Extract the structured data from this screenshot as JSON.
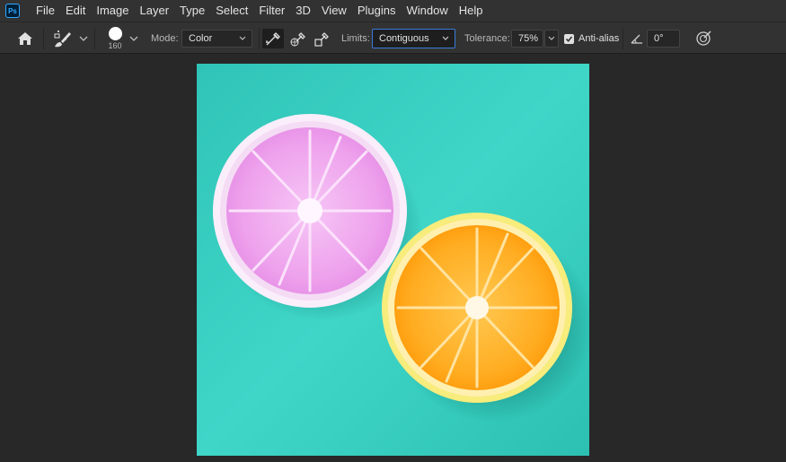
{
  "app": {
    "logo_text": "Ps"
  },
  "menu": {
    "items": [
      {
        "id": "file",
        "label": "File"
      },
      {
        "id": "edit",
        "label": "Edit"
      },
      {
        "id": "image",
        "label": "Image"
      },
      {
        "id": "layer",
        "label": "Layer"
      },
      {
        "id": "type",
        "label": "Type"
      },
      {
        "id": "select",
        "label": "Select"
      },
      {
        "id": "filter",
        "label": "Filter"
      },
      {
        "id": "3d",
        "label": "3D"
      },
      {
        "id": "view",
        "label": "View"
      },
      {
        "id": "plugins",
        "label": "Plugins"
      },
      {
        "id": "window",
        "label": "Window"
      },
      {
        "id": "help",
        "label": "Help"
      }
    ]
  },
  "options": {
    "home_icon": "home-icon",
    "tool_icon": "color-replacement-brush-icon",
    "brush_size": "160",
    "mode_label": "Mode:",
    "mode_value": "Color",
    "sampling_icons": [
      "sampling-continuous-icon",
      "sampling-once-icon",
      "sampling-background-swatch-icon"
    ],
    "limits_label": "Limits:",
    "limits_value": "Contiguous",
    "tolerance_label": "Tolerance:",
    "tolerance_value": "75%",
    "antialias_label": "Anti-alias",
    "antialias_checked": true,
    "angle_icon": "angle-icon",
    "angle_value": "0°",
    "pressure_icon": "pressure-size-icon"
  },
  "colors": {
    "background": "#3dd4c4",
    "pink_slice": "#f0a8f0",
    "orange_slice": "#ffb230",
    "focus_border": "#3b7bd8"
  }
}
